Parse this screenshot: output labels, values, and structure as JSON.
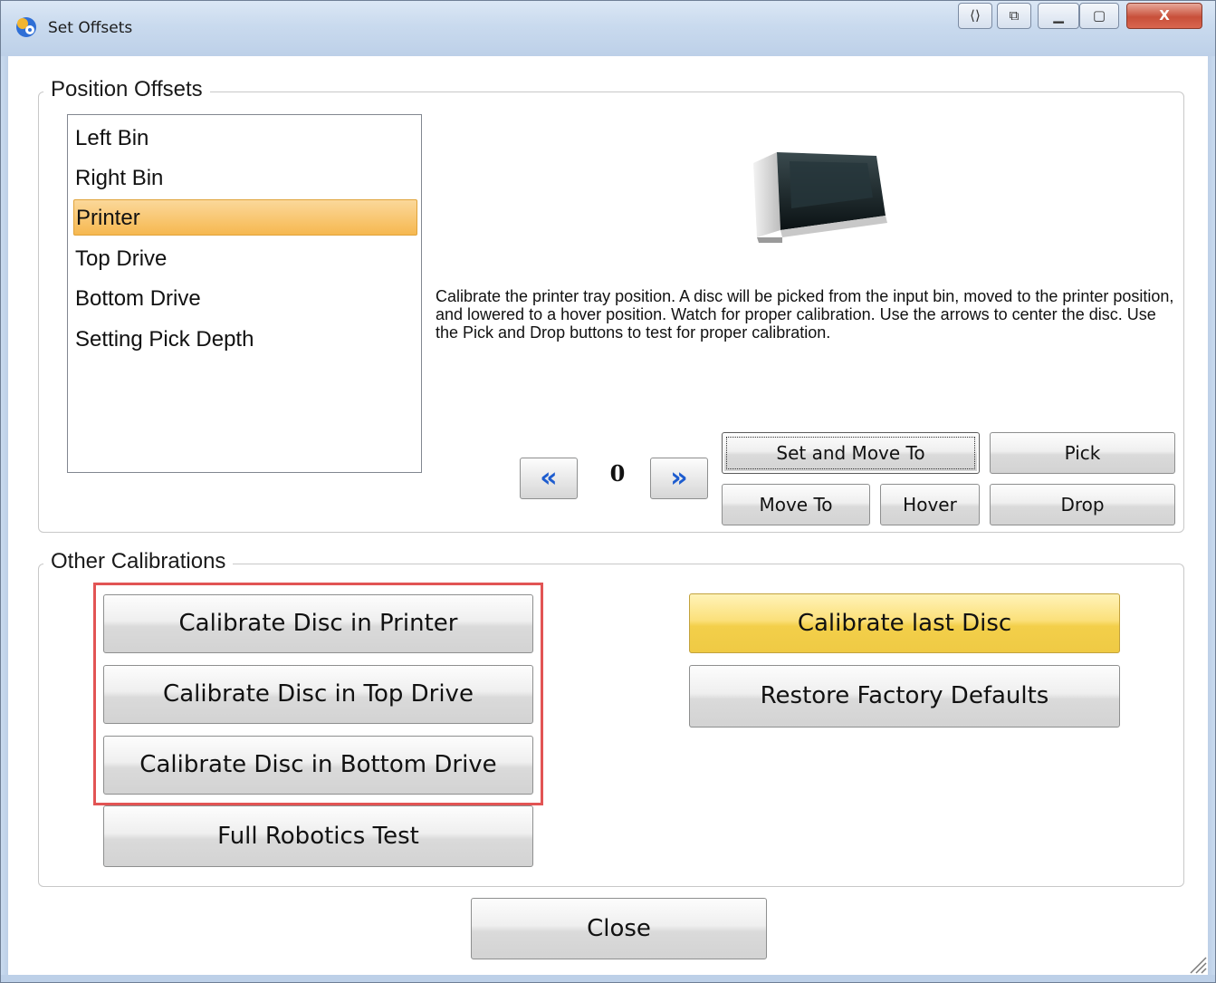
{
  "window": {
    "title": "Set Offsets",
    "controls": [
      "restore-down-icon",
      "minimize-icon",
      "maximize-icon",
      "close-icon"
    ],
    "title_buttons": {
      "dock": "⟨⟩",
      "snap": "⧉",
      "minimize": "▁",
      "maximize": "▢",
      "close": "X"
    }
  },
  "position_offsets": {
    "label": "Position Offsets",
    "items": [
      {
        "label": "Left Bin",
        "selected": false
      },
      {
        "label": "Right Bin",
        "selected": false
      },
      {
        "label": "Printer",
        "selected": true
      },
      {
        "label": "Top Drive",
        "selected": false
      },
      {
        "label": "Bottom Drive",
        "selected": false
      },
      {
        "label": "Setting Pick Depth",
        "selected": false
      }
    ],
    "description": "Calibrate the printer tray position. A disc will be picked from the input bin, moved to the printer position, and lowered to a hover position.  Watch for proper calibration.  Use the arrows to center the disc. Use the Pick and Drop buttons to test for proper calibration.",
    "counter": "0",
    "arrow_left": "«",
    "arrow_right": "»",
    "buttons": {
      "set_and_move_to": "Set and Move To",
      "pick": "Pick",
      "move_to": "Move To",
      "hover": "Hover",
      "drop": "Drop"
    }
  },
  "other_calibrations": {
    "label": "Other Calibrations",
    "buttons": {
      "calibrate_printer": "Calibrate Disc in Printer",
      "calibrate_top_drive": "Calibrate Disc in Top Drive",
      "calibrate_bottom_drive": "Calibrate Disc in Bottom Drive",
      "full_robotics_test": "Full Robotics Test",
      "calibrate_last_disc": "Calibrate last Disc",
      "restore_defaults": "Restore Factory Defaults"
    }
  },
  "footer": {
    "close": "Close"
  },
  "colors": {
    "selected_item": "#f6b850",
    "gold_button": "#f3cf4a",
    "arrow_blue": "#1d5ccf",
    "highlight_box": "#e25454"
  }
}
